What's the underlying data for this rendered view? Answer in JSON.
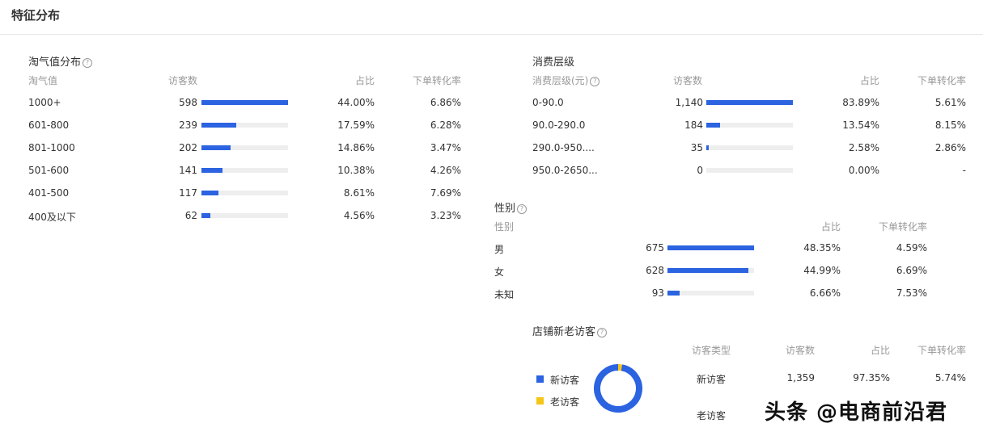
{
  "page_title": "特征分布",
  "taoqi": {
    "title": "淘气值分布",
    "help": "?",
    "headers": {
      "label": "淘气值",
      "visitors": "访客数",
      "ratio": "占比",
      "conv": "下单转化率"
    },
    "rows": [
      {
        "label": "1000+",
        "visitors": "598",
        "ratio": "44.00%",
        "conv": "6.86%",
        "fill": 1.0
      },
      {
        "label": "601-800",
        "visitors": "239",
        "ratio": "17.59%",
        "conv": "6.28%",
        "fill": 0.4
      },
      {
        "label": "801-1000",
        "visitors": "202",
        "ratio": "14.86%",
        "conv": "3.47%",
        "fill": 0.34
      },
      {
        "label": "501-600",
        "visitors": "141",
        "ratio": "10.38%",
        "conv": "4.26%",
        "fill": 0.24
      },
      {
        "label": "401-500",
        "visitors": "117",
        "ratio": "8.61%",
        "conv": "7.69%",
        "fill": 0.2
      },
      {
        "label": "400及以下",
        "visitors": "62",
        "ratio": "4.56%",
        "conv": "3.23%",
        "fill": 0.1
      }
    ]
  },
  "consume": {
    "title": "消费层级",
    "headers": {
      "label": "消费层级(元)",
      "visitors": "访客数",
      "ratio": "占比",
      "conv": "下单转化率"
    },
    "rows": [
      {
        "label": "0-90.0",
        "visitors": "1,140",
        "ratio": "83.89%",
        "conv": "5.61%",
        "fill": 1.0
      },
      {
        "label": "90.0-290.0",
        "visitors": "184",
        "ratio": "13.54%",
        "conv": "8.15%",
        "fill": 0.16
      },
      {
        "label": "290.0-950....",
        "visitors": "35",
        "ratio": "2.58%",
        "conv": "2.86%",
        "fill": 0.03
      },
      {
        "label": "950.0-2650...",
        "visitors": "0",
        "ratio": "0.00%",
        "conv": "-",
        "fill": 0
      }
    ]
  },
  "gender": {
    "title": "性别",
    "headers": {
      "label": "性别",
      "ratio": "占比",
      "conv": "下单转化率"
    },
    "rows": [
      {
        "label": "男",
        "visitors": "675",
        "ratio": "48.35%",
        "conv": "4.59%",
        "fill": 1.0
      },
      {
        "label": "女",
        "visitors": "628",
        "ratio": "44.99%",
        "conv": "6.69%",
        "fill": 0.93
      },
      {
        "label": "未知",
        "visitors": "93",
        "ratio": "6.66%",
        "conv": "7.53%",
        "fill": 0.14
      }
    ]
  },
  "store": {
    "title": "店铺新老访客",
    "legend": [
      {
        "label": "新访客",
        "color": "#2b63e0"
      },
      {
        "label": "老访客",
        "color": "#f5c518"
      }
    ],
    "donut": {
      "new_ratio": 97.35,
      "old_ratio": 2.65
    },
    "headers": {
      "type": "访客类型",
      "visitors": "访客数",
      "ratio": "占比",
      "conv": "下单转化率"
    },
    "rows": [
      {
        "type": "新访客",
        "visitors": "1,359",
        "ratio": "97.35%",
        "conv": "5.74%"
      },
      {
        "type": "老访客",
        "visitors": "",
        "ratio": "",
        "conv": ""
      }
    ]
  },
  "watermark": "头条 @电商前沿君"
}
